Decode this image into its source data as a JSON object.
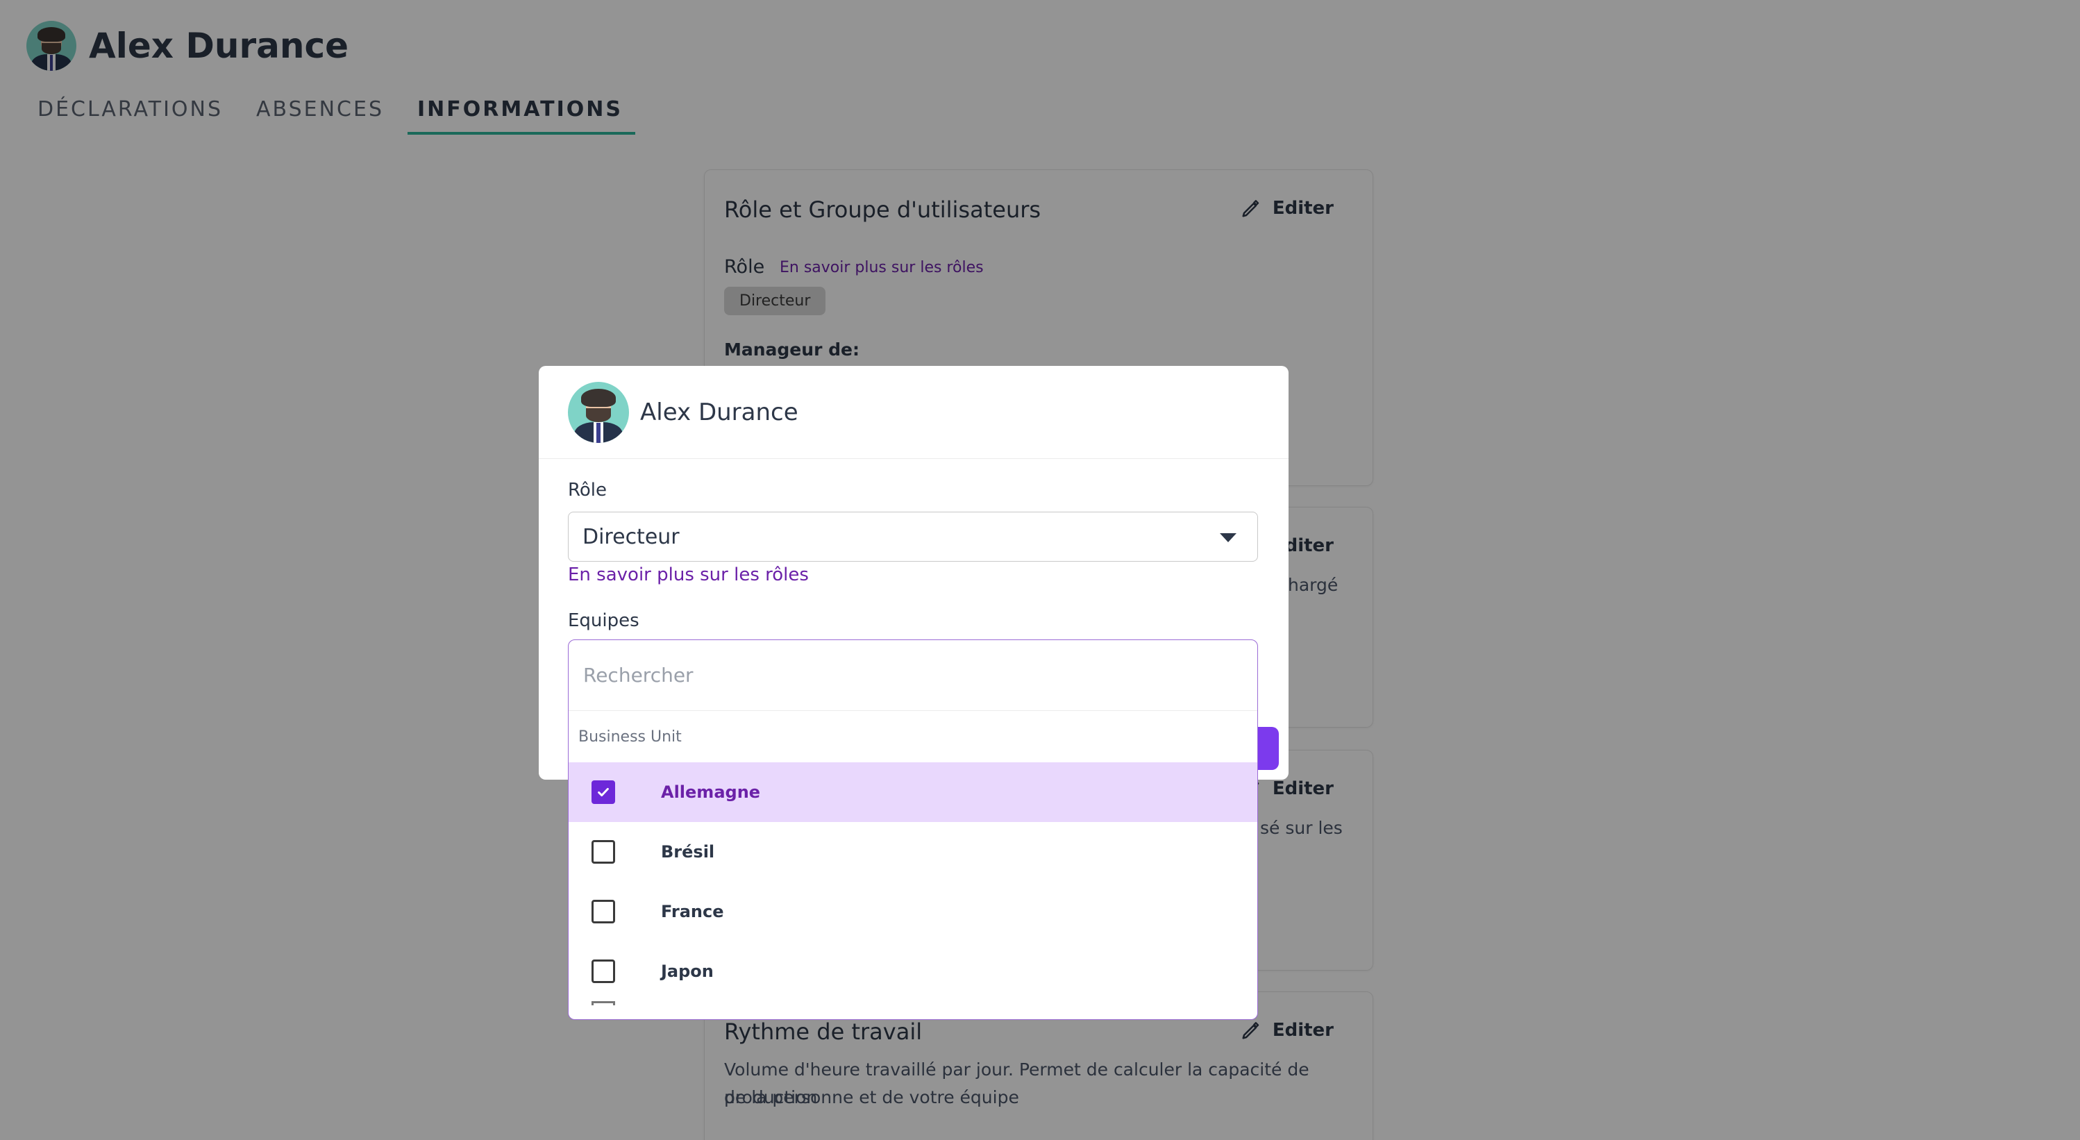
{
  "header": {
    "name": "Alex Durance"
  },
  "tabs": [
    {
      "label": "DÉCLARATIONS"
    },
    {
      "label": "ABSENCES"
    },
    {
      "label": "INFORMATIONS"
    }
  ],
  "cards": {
    "role_group": {
      "title": "Rôle et Groupe d'utilisateurs",
      "edit": "Editer",
      "role_label": "Rôle",
      "role_link": "En savoir plus sur les rôles",
      "role_chip": "Directeur",
      "manager_label": "Manageur de:"
    },
    "card2": {
      "edit": "Editer",
      "partial_text": "hargé"
    },
    "card3": {
      "edit": "Editer",
      "partial_text": "sé sur les"
    },
    "work_rhythm": {
      "title": "Rythme de travail",
      "edit": "Editer",
      "description_line1": "Volume d'heure travaillé par jour. Permet de calculer la capacité de production",
      "description_line2": "de la personne et de votre équipe"
    }
  },
  "modal": {
    "name": "Alex Durance",
    "role_label": "Rôle",
    "role_value": "Directeur",
    "role_link": "En savoir plus sur les rôles",
    "teams_label": "Equipes"
  },
  "dropdown": {
    "search_placeholder": "Rechercher",
    "group": "Business Unit",
    "items": [
      {
        "label": "Allemagne",
        "checked": true
      },
      {
        "label": "Brésil",
        "checked": false
      },
      {
        "label": "France",
        "checked": false
      },
      {
        "label": "Japon",
        "checked": false
      }
    ]
  },
  "colors": {
    "accent": "#6d28d9",
    "tab_underline": "#2eb59a",
    "selected_row": "#e9d8fd",
    "link": "#6b21a8"
  }
}
